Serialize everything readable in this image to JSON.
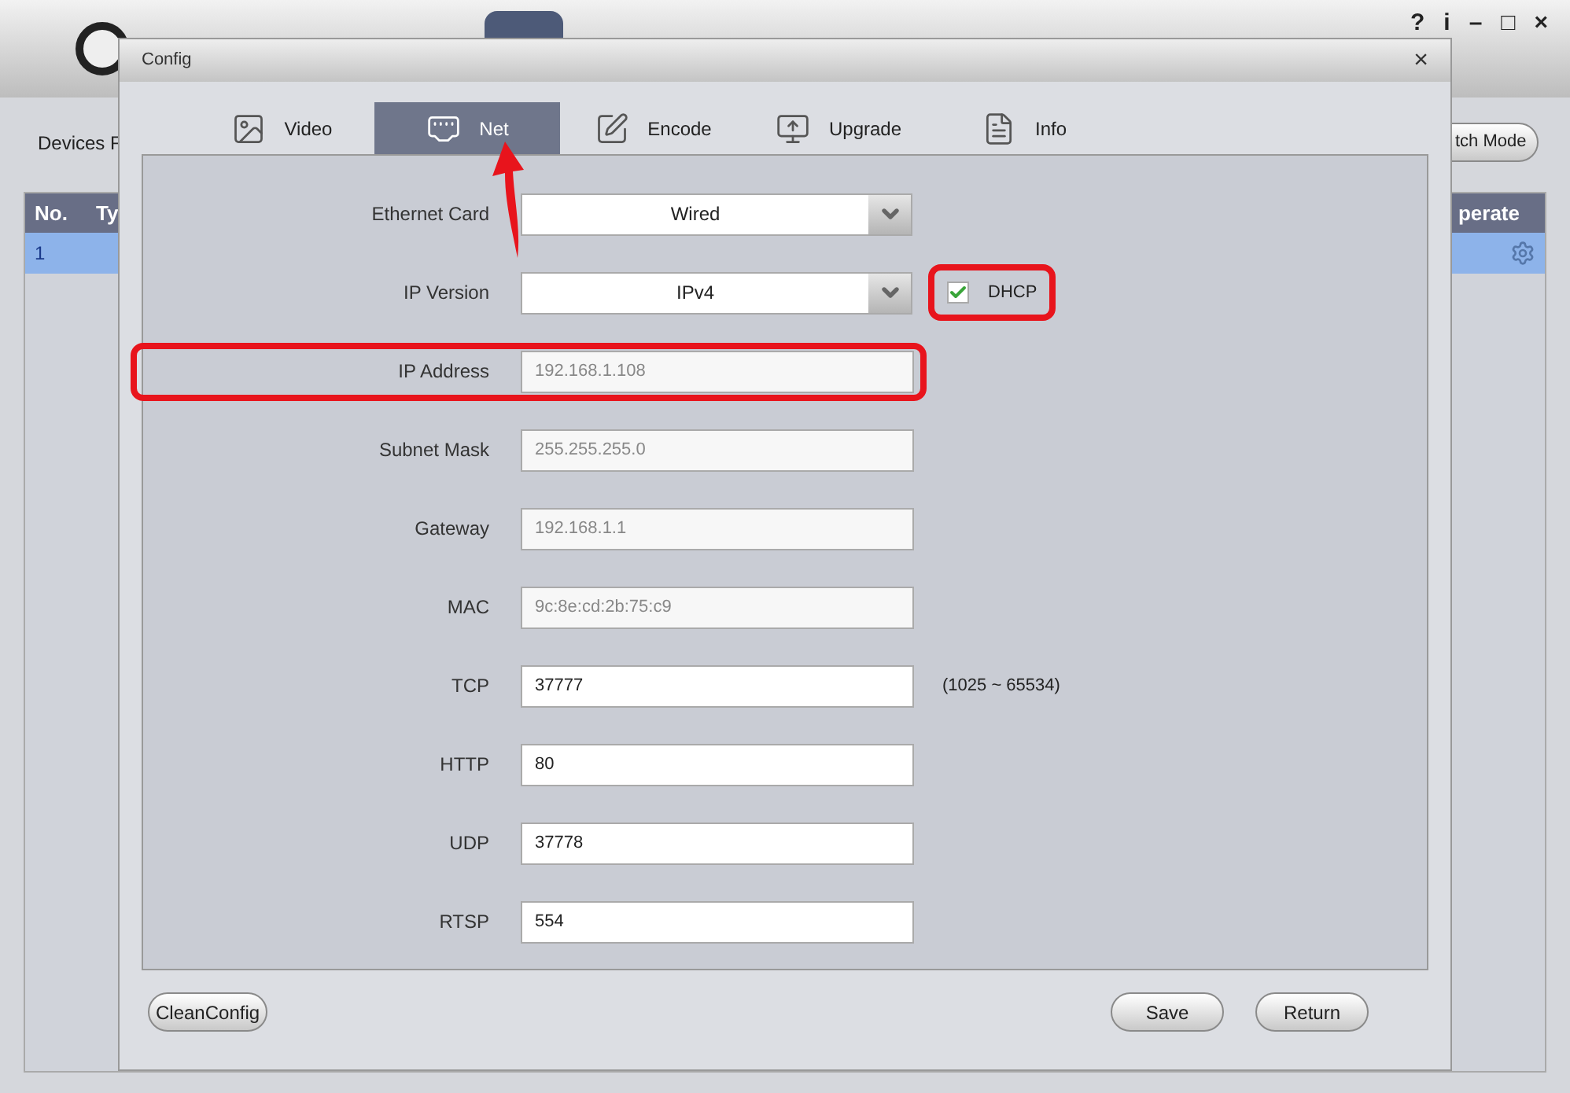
{
  "app": {
    "window_controls": [
      "?",
      "i",
      "–",
      "□",
      "×"
    ],
    "devices_label": "Devices F",
    "mode_button": "tch Mode",
    "table": {
      "columns": [
        "No.",
        "Ty",
        "perate"
      ],
      "rows": [
        {
          "cells": [
            "1"
          ],
          "selected": true
        }
      ]
    }
  },
  "dialog": {
    "title": "Config",
    "close": "×",
    "tabs": [
      {
        "label": "Video",
        "selected": false
      },
      {
        "label": "Net",
        "selected": true
      },
      {
        "label": "Encode",
        "selected": false
      },
      {
        "label": "Upgrade",
        "selected": false
      },
      {
        "label": "Info",
        "selected": false
      }
    ],
    "fields": [
      {
        "label": "Ethernet Card",
        "kind": "dropdown",
        "value": "Wired",
        "highlighted": false
      },
      {
        "label": "IP Version",
        "kind": "dropdown",
        "value": "IPv4",
        "highlighted": false,
        "checkbox": {
          "label": "DHCP",
          "checked": true,
          "highlighted": true
        }
      },
      {
        "label": "IP Address",
        "kind": "text",
        "value": "192.168.1.108",
        "disabled": true,
        "highlighted": true
      },
      {
        "label": "Subnet Mask",
        "kind": "text",
        "value": "255.255.255.0",
        "disabled": true,
        "highlighted": false
      },
      {
        "label": "Gateway",
        "kind": "text",
        "value": "192.168.1.1",
        "disabled": true,
        "highlighted": false
      },
      {
        "label": "MAC",
        "kind": "text",
        "value": "9c:8e:cd:2b:75:c9",
        "disabled": true,
        "highlighted": false
      },
      {
        "label": "TCP",
        "kind": "text",
        "value": "37777",
        "disabled": false,
        "highlighted": false,
        "hint": "(1025 ~ 65534)"
      },
      {
        "label": "HTTP",
        "kind": "text",
        "value": "80",
        "disabled": false,
        "highlighted": false
      },
      {
        "label": "UDP",
        "kind": "text",
        "value": "37778",
        "disabled": false,
        "highlighted": false
      },
      {
        "label": "RTSP",
        "kind": "text",
        "value": "554",
        "disabled": false,
        "highlighted": false
      }
    ],
    "buttons": {
      "left": "CleanConfig",
      "right": [
        "Save",
        "Return"
      ]
    }
  }
}
